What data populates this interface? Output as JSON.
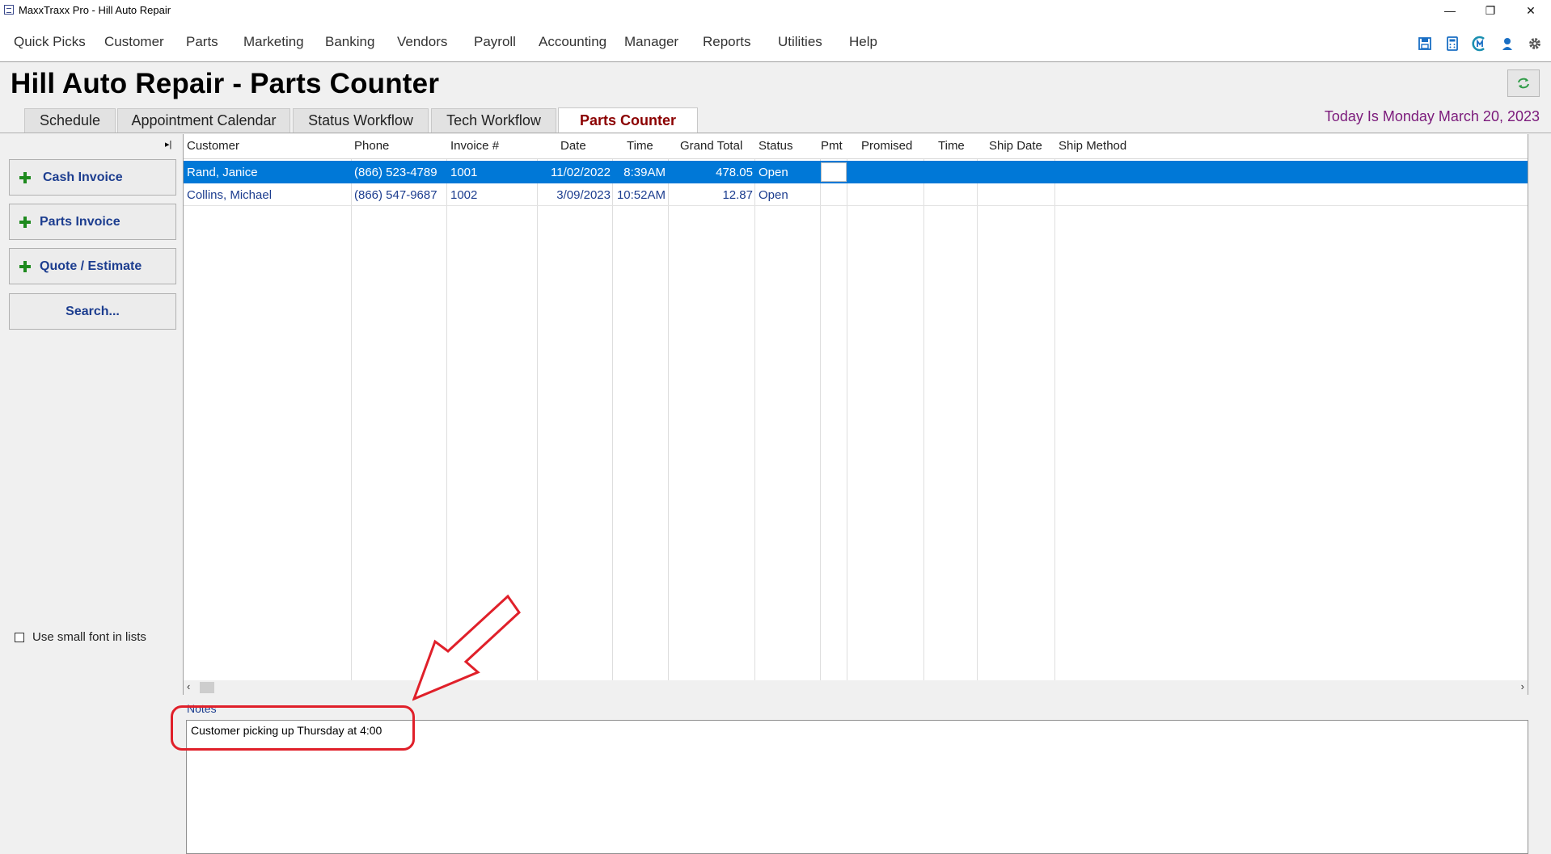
{
  "window": {
    "title": "MaxxTraxx Pro - Hill Auto Repair",
    "minimize": "—",
    "restore": "❐",
    "close": "✕"
  },
  "menu": [
    "Quick Picks",
    "Customer",
    "Parts",
    "Marketing",
    "Banking",
    "Vendors",
    "Payroll",
    "Accounting",
    "Manager",
    "Reports",
    "Utilities",
    "Help"
  ],
  "toolbar_icons": [
    "save-icon",
    "calculator-icon",
    "maxx-logo-icon",
    "user-help-icon",
    "settings-gear-icon"
  ],
  "header": {
    "title": "Hill Auto Repair - Parts Counter",
    "today": "Today Is Monday March 20, 2023"
  },
  "tabs": [
    "Schedule",
    "Appointment Calendar",
    "Status Workflow",
    "Tech Workflow",
    "Parts Counter"
  ],
  "active_tab": "Parts Counter",
  "sidebar": {
    "buttons": [
      "Cash Invoice",
      "Parts Invoice",
      "Quote / Estimate",
      "Search..."
    ],
    "small_font_label": "Use small font in lists",
    "small_font_checked": false
  },
  "grid": {
    "columns": [
      "Customer",
      "Phone",
      "Invoice #",
      "Date",
      "Time",
      "Grand Total",
      "Status",
      "Pmt",
      "Promised",
      "Time",
      "Ship Date",
      "Ship Method"
    ],
    "rows": [
      {
        "customer": "Rand, Janice",
        "phone": "(866) 523-4789",
        "invoice": "1001",
        "date": "11/02/2022",
        "time": "8:39AM",
        "grand_total": "478.05",
        "status": "Open",
        "pmt": "",
        "promised": "",
        "promised_time": "",
        "ship_date": "",
        "ship_method": "",
        "selected": true
      },
      {
        "customer": "Collins, Michael",
        "phone": "(866) 547-9687",
        "invoice": "1002",
        "date": "3/09/2023",
        "time": "10:52AM",
        "grand_total": "12.87",
        "status": "Open",
        "pmt": "",
        "promised": "",
        "promised_time": "",
        "ship_date": "",
        "ship_method": "",
        "selected": false
      }
    ]
  },
  "notes": {
    "label": "Notes",
    "text": "Customer picking up Thursday at 4:00"
  },
  "colors": {
    "selection": "#0078d7",
    "link_blue": "#1c3d8f",
    "today_purple": "#7b1a7b",
    "active_tab_red": "#8b0000",
    "annotation_red": "#e0202a",
    "plus_green": "#1e8a1e"
  }
}
